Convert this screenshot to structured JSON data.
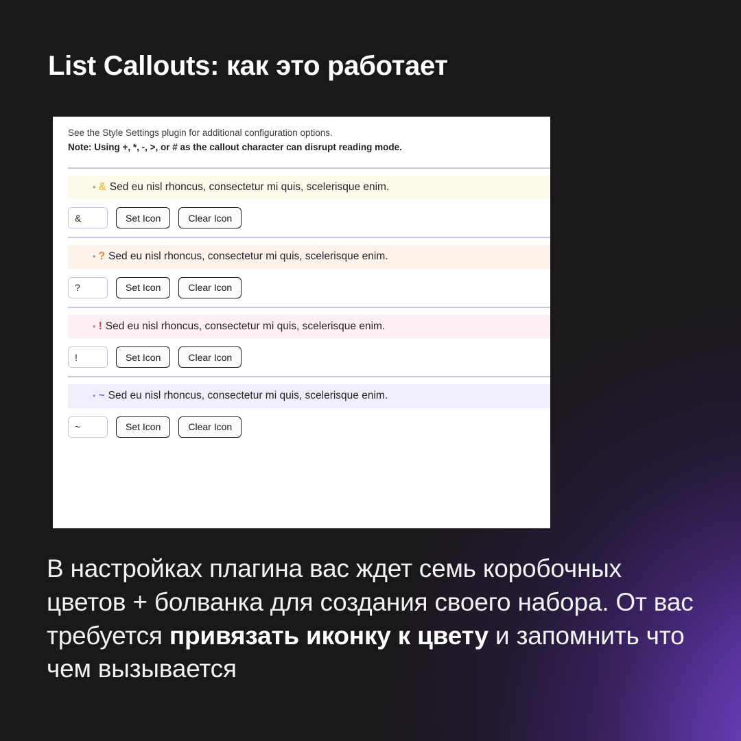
{
  "title": "List Callouts: как это работает",
  "panel": {
    "header": {
      "line1": "See the Style Settings plugin for additional configuration options.",
      "line2": "Note: Using +, *, -, >, or # as the callout character can disrupt reading mode."
    },
    "sample_text": "Sed eu nisl rhoncus, consectetur mi quis, scelerisque enim.",
    "bullet_glyph": "•",
    "buttons": {
      "set_icon": "Set Icon",
      "clear_icon": "Clear Icon"
    },
    "rows": [
      {
        "char": "&",
        "input_value": "&",
        "char_color": "#e8c33f",
        "tint": "tint-yellow",
        "divider_color": "#c9c6e8"
      },
      {
        "char": "?",
        "input_value": "?",
        "char_color": "#e08a2e",
        "tint": "tint-orange",
        "divider_color": "#c9c6e8"
      },
      {
        "char": "!",
        "input_value": "!",
        "char_color": "#e0325c",
        "tint": "tint-red",
        "divider_color": "#c9c6e8"
      },
      {
        "char": "~",
        "input_value": "~",
        "char_color": "#7b5fe0",
        "tint": "tint-purple",
        "divider_color": "#c9c6e8"
      }
    ]
  },
  "caption": {
    "part1": "В настройках плагина вас ждет семь коробочных цветов + болванка для создания своего набора. От вас требуется ",
    "bold1": "привязать иконку к цвету",
    "part2": " и запомнить что чем вызывается"
  },
  "colors": {
    "background": "#1a1819",
    "accent_purple": "#8a56e2",
    "panel": "#ffffff",
    "title_text": "#ffffff"
  }
}
